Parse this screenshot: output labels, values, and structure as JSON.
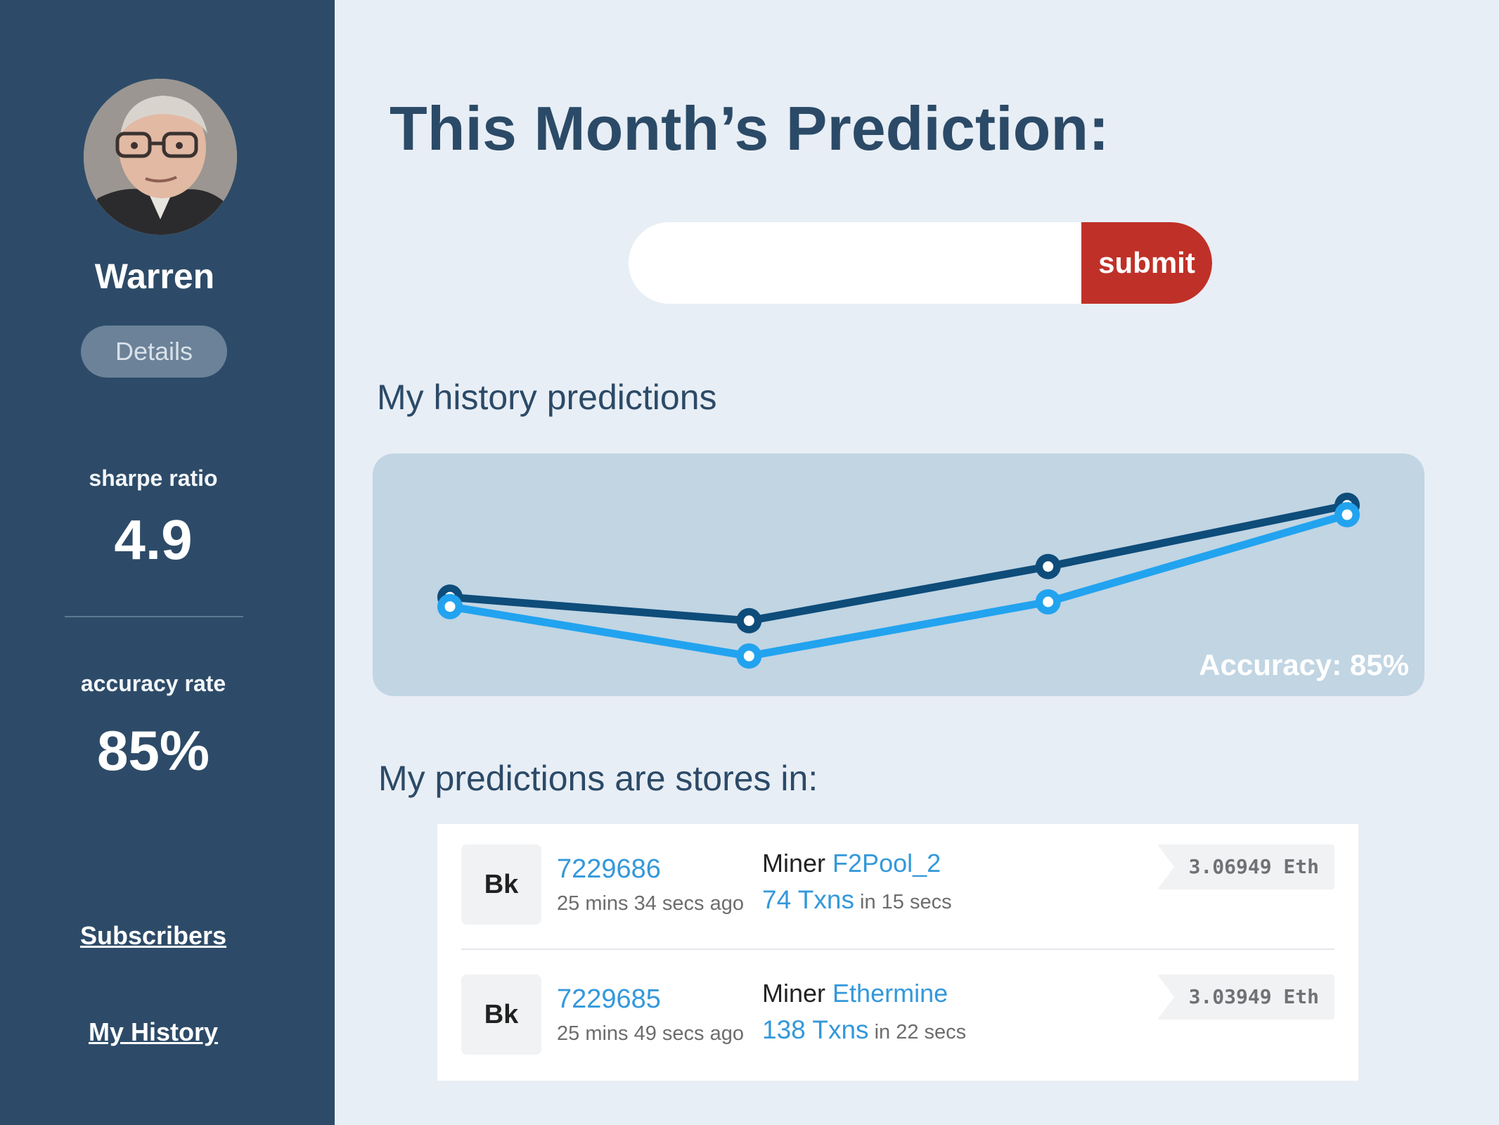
{
  "profile": {
    "name": "Warren",
    "details_label": "Details"
  },
  "stats": {
    "sharpe_label": "sharpe ratio",
    "sharpe_value": "4.9",
    "accuracy_label": "accuracy rate",
    "accuracy_value": "85%"
  },
  "sidebar_links": {
    "subscribers": "Subscribers",
    "history": "My History"
  },
  "main": {
    "title": "This Month’s Prediction:",
    "input_value": "",
    "submit_label": "submit",
    "history_heading": "My history predictions",
    "stores_heading": "My predictions are stores in:"
  },
  "colors": {
    "sidebar": "#2d4b68",
    "submit": "#bf3128",
    "series_dark": "#0e4c7a",
    "series_light": "#22a3ef",
    "link": "#3498db"
  },
  "chart_data": {
    "type": "line",
    "title": "",
    "xlabel": "",
    "ylabel": "",
    "x": [
      1,
      2,
      3,
      4
    ],
    "grid": false,
    "series": [
      {
        "values": [
          42,
          32,
          55,
          81
        ],
        "color": "#0e4c7a"
      },
      {
        "values": [
          38,
          17,
          40,
          77
        ],
        "color": "#22a3ef"
      }
    ],
    "ylim": [
      0,
      100
    ],
    "annotation": "Accuracy: 85%"
  },
  "blocks": [
    {
      "badge": "Bk",
      "number": "7229686",
      "age": "25 mins 34 secs ago",
      "miner_prefix": "Miner",
      "miner": "F2Pool_2",
      "txns": "74 Txns",
      "txns_time": "in 15 secs",
      "reward": "3.06949 Eth"
    },
    {
      "badge": "Bk",
      "number": "7229685",
      "age": "25 mins 49 secs ago",
      "miner_prefix": "Miner",
      "miner": "Ethermine",
      "txns": "138 Txns",
      "txns_time": "in 22 secs",
      "reward": "3.03949 Eth"
    }
  ]
}
